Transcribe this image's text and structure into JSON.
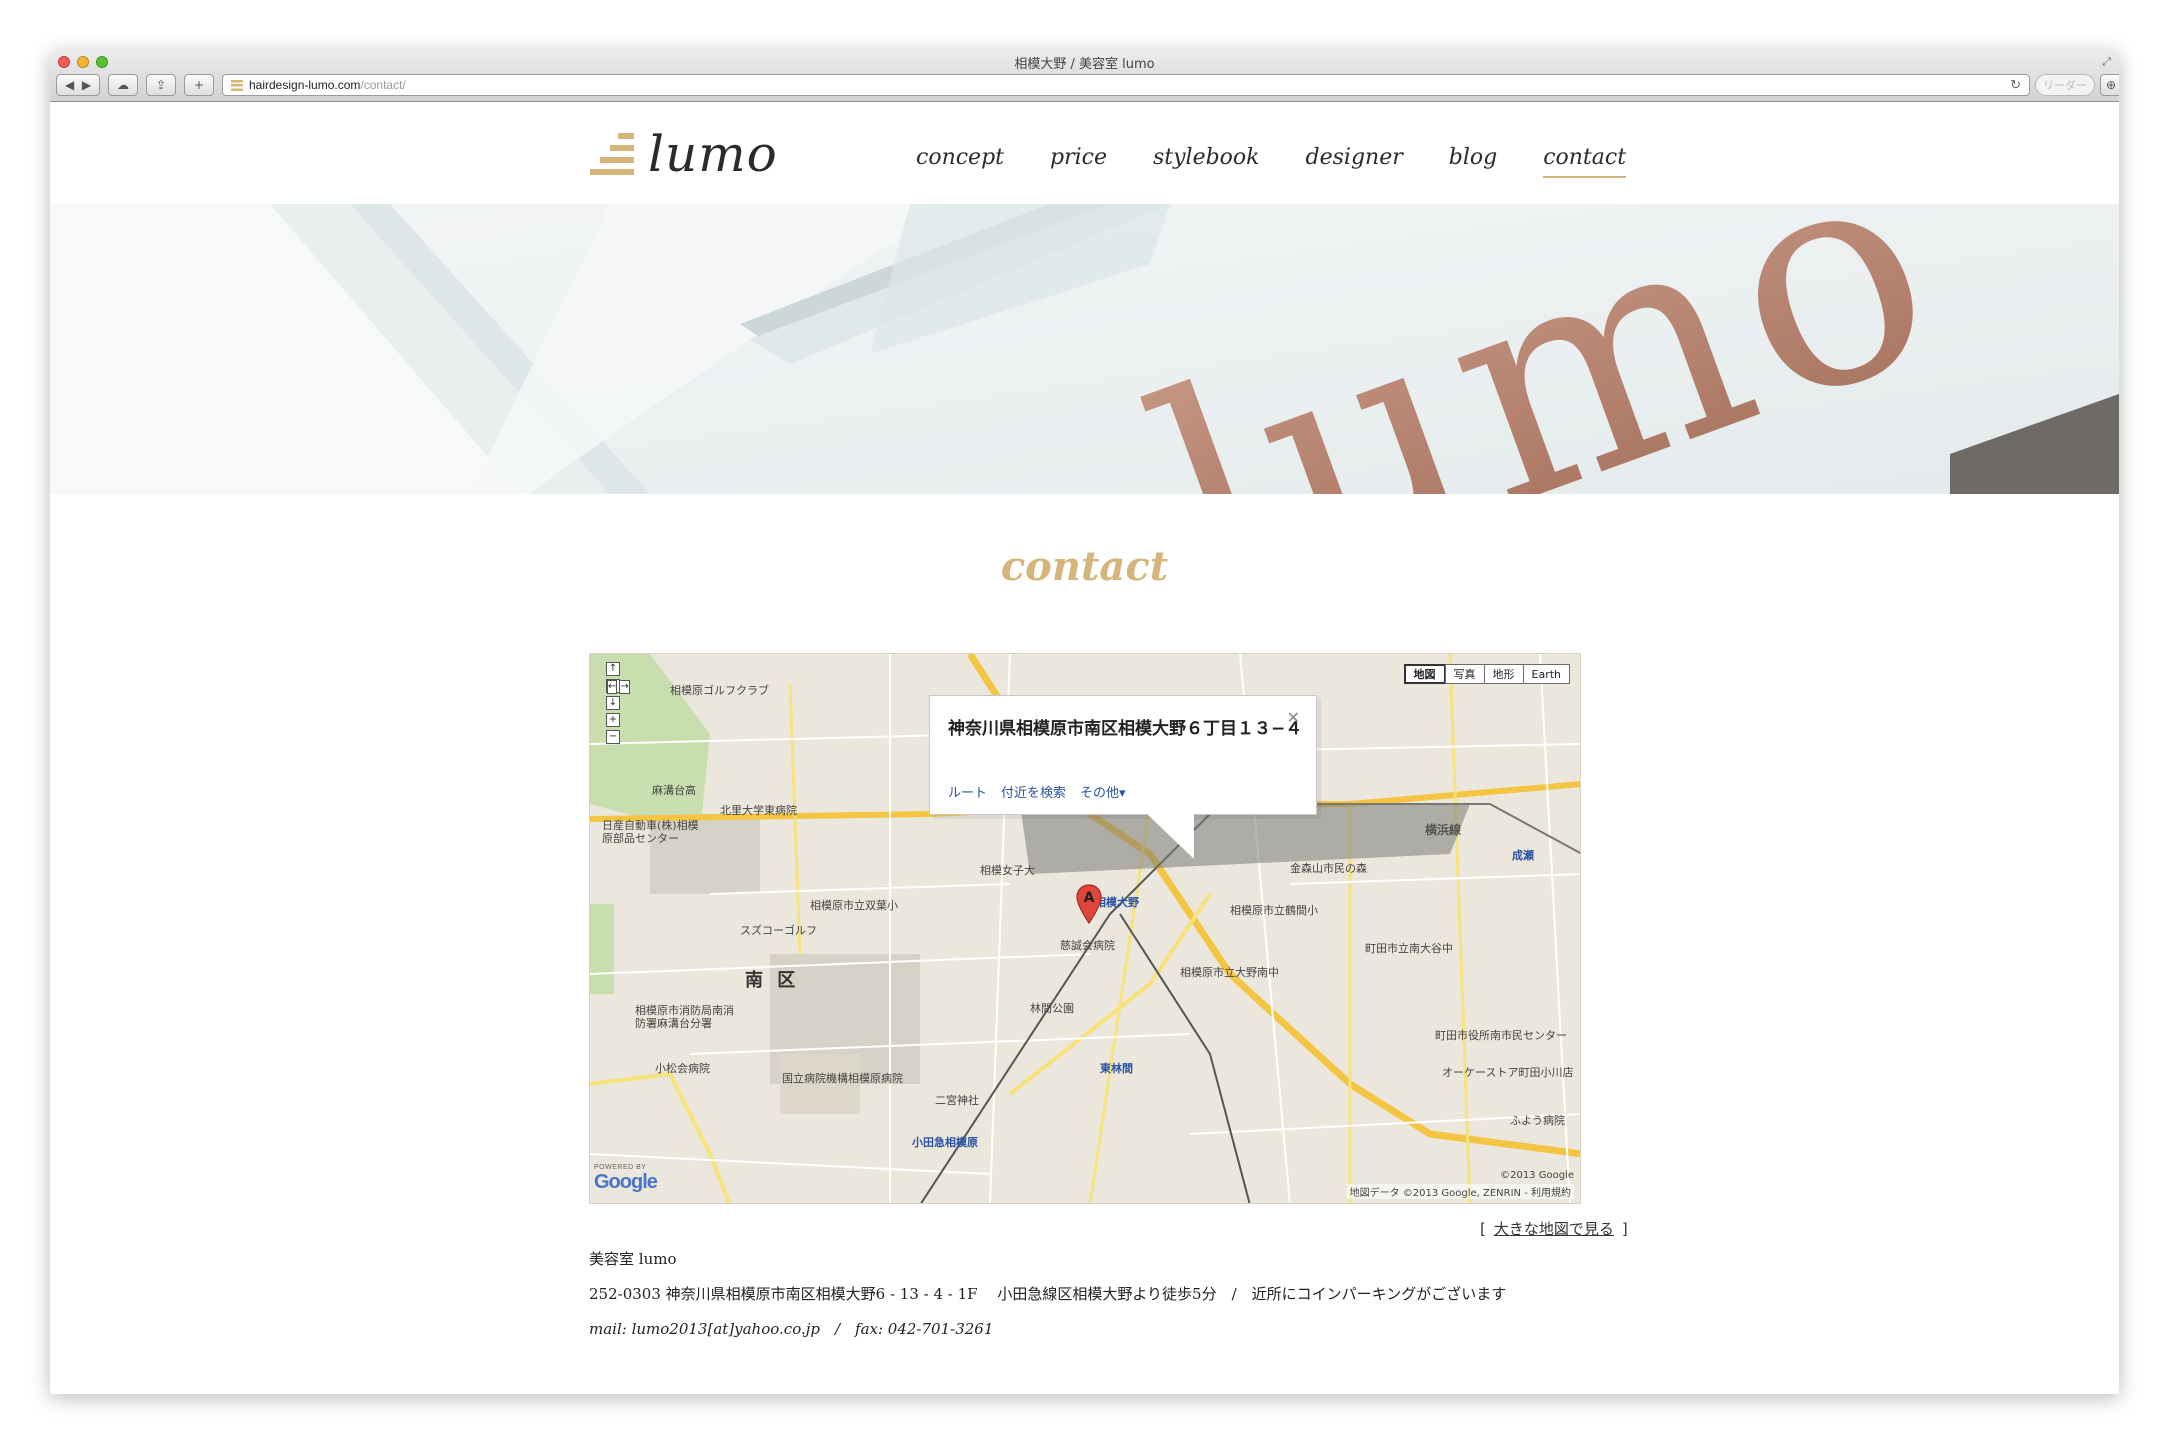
{
  "browser": {
    "window_title": "相模大野 / 美容室 lumo",
    "url_host": "hairdesign-lumo.com",
    "url_path": "/contact/",
    "reader_label": "リーダー"
  },
  "site": {
    "logo_text": "lumo",
    "nav": [
      {
        "label": "concept"
      },
      {
        "label": "price"
      },
      {
        "label": "stylebook"
      },
      {
        "label": "designer"
      },
      {
        "label": "blog"
      },
      {
        "label": "contact",
        "active": true
      }
    ],
    "hero_sign_text": "lumo",
    "page_title": "contact"
  },
  "map": {
    "type_buttons": [
      "地図",
      "写真",
      "地形",
      "Earth"
    ],
    "info_window": {
      "address": "神奈川県相模原市南区相模大野６丁目１３−４",
      "links": [
        "ルート",
        "付近を検索",
        "その他"
      ]
    },
    "marker_letter": "A",
    "labels": {
      "district": "南 区",
      "station": "相模大野",
      "line1": "横浜線",
      "station2": "東林間",
      "station3": "成瀬",
      "hospital": "慈誠会病院",
      "park": "林間公園",
      "school1": "相模女子大",
      "golf": "相模原ゴルフクラブ",
      "asamizo": "麻溝台高",
      "kitasato": "北里大学東病院",
      "nissan": "日産自動車(株)相模原部品センター",
      "suzuko": "スズコーゴルフ",
      "fire": "相模原市消防局南消防署麻溝台分署",
      "komatsu": "小松会病院",
      "national": "国立病院機構相模原病院",
      "ninomiya": "二宮神社",
      "machida": "町田市立南大谷中",
      "ozaki": "町田市役所南市民センター",
      "okaeru": "オーケーストア町田小川店",
      "futaba": "ふよう病院",
      "odakyu": "小田急相模原",
      "kinmori": "金森山市民の森",
      "tsurumaki": "相模原市立鶴間小",
      "oono_jr": "相模原市立大野南中",
      "kita_nishi": "相模原市立双葉小"
    },
    "google_powered": "POWERED BY",
    "google_logo": "Google",
    "copyright": "地図データ ©2013 Google, ZENRIN - 利用規約",
    "copyright2": "©2013 Google"
  },
  "bigmap_link": {
    "open": "[",
    "label": "大きな地図で見る",
    "close": "]"
  },
  "info": {
    "name": "美容室 lumo",
    "address_line": "252-0303 神奈川県相模原市南区相模大野6 - 13 - 4 - 1F　 小田急線区相模大野より徒歩5分　/　近所にコインパーキングがございます",
    "contact_line": "mail: lumo2013[at]yahoo.co.jp　/　fax: 042-701-3261"
  },
  "colors": {
    "accent": "#d5b57c",
    "map_road": "#f4c542",
    "link": "#2a53a3"
  }
}
